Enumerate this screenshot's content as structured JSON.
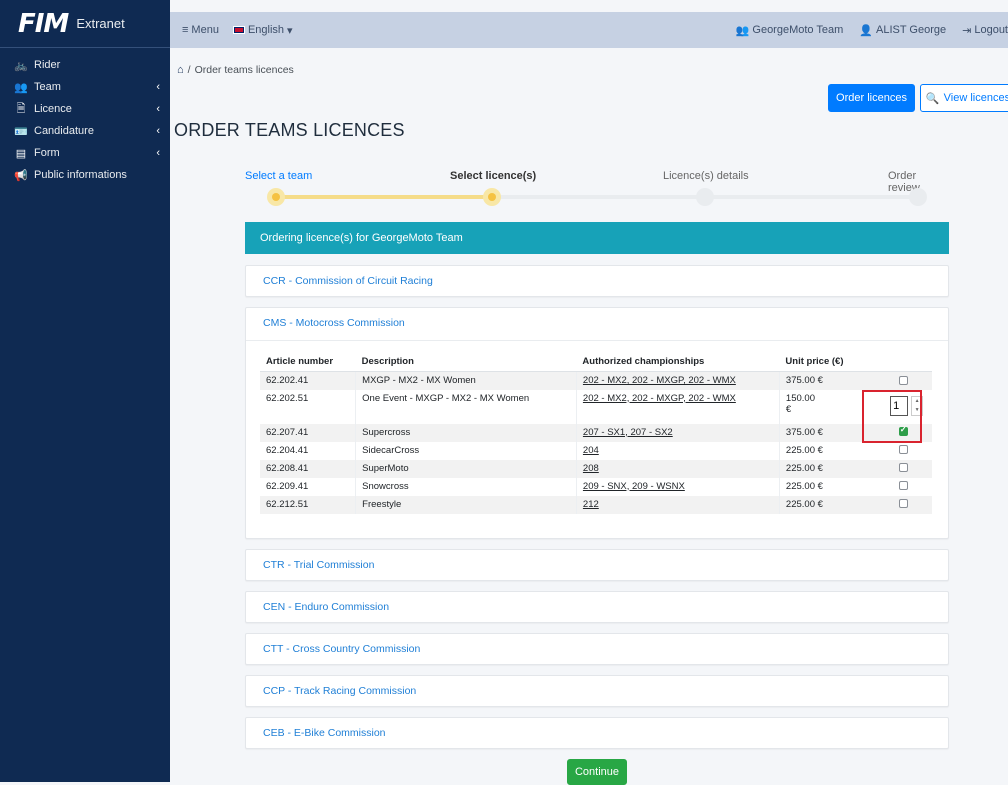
{
  "brand": {
    "logo": "FIM",
    "name": "Extranet"
  },
  "sidebar": {
    "items": [
      {
        "label": "Rider",
        "icon": "bicycle-icon",
        "glyph": "🚲",
        "chevron": ""
      },
      {
        "label": "Team",
        "icon": "users-icon",
        "glyph": "👥",
        "chevron": "‹"
      },
      {
        "label": "Licence",
        "icon": "file-icon",
        "glyph": "🗎",
        "chevron": "‹"
      },
      {
        "label": "Candidature",
        "icon": "id-card-icon",
        "glyph": "🪪",
        "chevron": "‹"
      },
      {
        "label": "Form",
        "icon": "list-icon",
        "glyph": "▤",
        "chevron": "‹"
      },
      {
        "label": "Public informations",
        "icon": "bullhorn-icon",
        "glyph": "📢",
        "chevron": ""
      }
    ]
  },
  "topbar": {
    "menu_label": "Menu",
    "menu_glyph": "≡",
    "language": "English",
    "language_caret": "▾",
    "team": "GeorgeMoto Team",
    "team_glyph": "👥",
    "user": "ALIST George",
    "user_glyph": "👤",
    "logout": "Logout",
    "logout_glyph": "⇥"
  },
  "breadcrumb": {
    "home_glyph": "⌂",
    "separator": "/",
    "current": "Order teams licences"
  },
  "actions": {
    "order_label": "Order licences",
    "view_label": "View licences",
    "view_glyph": "🔍"
  },
  "page_title": "ORDER TEAMS LICENCES",
  "stepper": {
    "steps": [
      "Select a team",
      "Select licence(s)",
      "Licence(s) details",
      "Order review"
    ]
  },
  "header_bar": "Ordering licence(s) for GeorgeMoto Team",
  "commissions": {
    "ccr": "CCR - Commission of Circuit Racing",
    "cms": "CMS - Motocross Commission",
    "ctr": "CTR - Trial Commission",
    "cen": "CEN - Enduro Commission",
    "ctt": "CTT - Cross Country Commission",
    "ccp": "CCP - Track Racing Commission",
    "ceb": "CEB - E-Bike Commission"
  },
  "table": {
    "headers": [
      "Article number",
      "Description",
      "Authorized championships",
      "Unit price (€)"
    ],
    "rows": [
      {
        "article": "62.202.41",
        "description": "MXGP - MX2 - MX Women",
        "championships": "202 - MX2, 202 - MXGP, 202 - WMX",
        "price": "375.00 €"
      },
      {
        "article": "62.202.51",
        "description": "One Event - MXGP - MX2 - MX Women",
        "championships": "202 - MX2, 202 - MXGP, 202 - WMX",
        "price": "150.00 €",
        "quantity": "1"
      },
      {
        "article": "62.207.41",
        "description": "Supercross",
        "championships": "207 - SX1, 207 - SX2",
        "price": "375.00 €"
      },
      {
        "article": "62.204.41",
        "description": "SidecarCross",
        "championships": "204",
        "price": "225.00 €"
      },
      {
        "article": "62.208.41",
        "description": "SuperMoto",
        "championships": "208",
        "price": "225.00 €"
      },
      {
        "article": "62.209.41",
        "description": "Snowcross",
        "championships": "209 - SNX, 209 - WSNX",
        "price": "225.00 €"
      },
      {
        "article": "62.212.51",
        "description": "Freestyle",
        "championships": "212",
        "price": "225.00 €"
      }
    ],
    "spin_up": "▲",
    "spin_down": "▼"
  },
  "continue_label": "Continue"
}
